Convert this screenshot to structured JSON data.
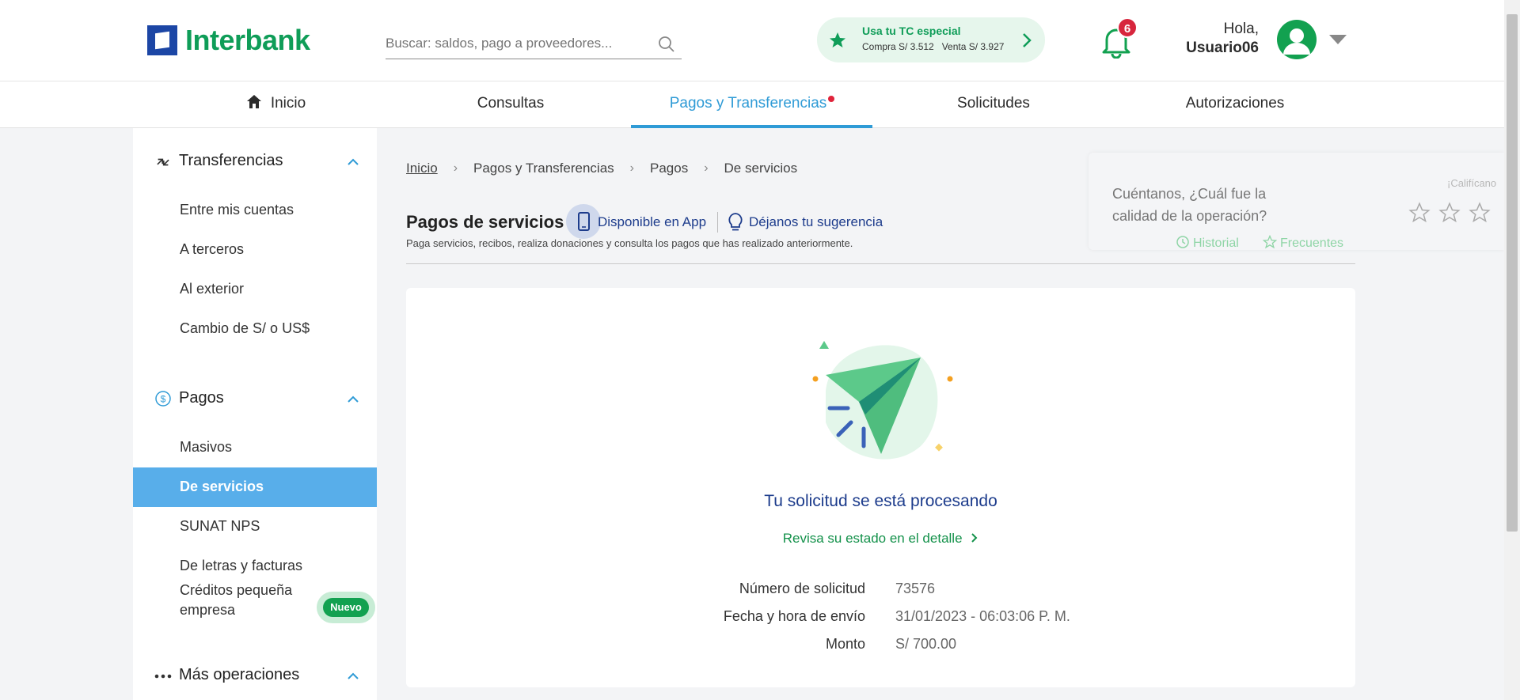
{
  "header": {
    "logo_text": "Interbank",
    "search_placeholder": "Buscar: saldos, pago a proveedores...",
    "tc": {
      "title": "Usa tu TC especial",
      "rates": "Compra S/ 3.512   Venta S/ 3.927"
    },
    "notifications_count": "6",
    "greeting": "Hola,",
    "username": "Usuario06"
  },
  "nav": {
    "items": [
      "Inicio",
      "Consultas",
      "Pagos y Transferencias",
      "Solicitudes",
      "Autorizaciones"
    ],
    "active": "Pagos y Transferencias"
  },
  "sidebar": {
    "transferencias": {
      "title": "Transferencias",
      "items": [
        "Entre mis cuentas",
        "A terceros",
        "Al exterior",
        "Cambio de S/ o US$"
      ]
    },
    "pagos": {
      "title": "Pagos",
      "items": [
        "Masivos",
        "De servicios",
        "SUNAT NPS",
        "De letras y facturas",
        "Créditos pequeña empresa"
      ],
      "active": "De servicios",
      "badge": "Nuevo"
    },
    "mas": {
      "title": "Más operaciones"
    }
  },
  "breadcrumb": [
    "Inicio",
    "Pagos y Transferencias",
    "Pagos",
    "De servicios"
  ],
  "page": {
    "title": "Pagos de servicios",
    "app_link": "Disponible en App",
    "suggest_link": "Déjanos tu sugerencia",
    "description": "Paga servicios, recibos, realiza donaciones y consulta los pagos que has realizado anteriormente."
  },
  "rating": {
    "question": "Cuéntanos, ¿Cuál fue la calidad de la operación?",
    "label": "¡Califícano",
    "historial": "Historial",
    "frecuentes": "Frecuentes"
  },
  "result": {
    "title": "Tu solicitud se está procesando",
    "link": "Revisa su estado en el detalle",
    "fields": [
      {
        "label": "Número de solicitud",
        "value": "73576"
      },
      {
        "label": "Fecha y hora de envío",
        "value": "31/01/2023 - 06:03:06 P. M."
      },
      {
        "label": "Monto",
        "value": "S/ 700.00"
      }
    ]
  },
  "colors": {
    "brand_green": "#0f9d58",
    "brand_blue": "#1c46a5",
    "accent": "#2f9bd6",
    "active_sidebar": "#58aeea"
  }
}
